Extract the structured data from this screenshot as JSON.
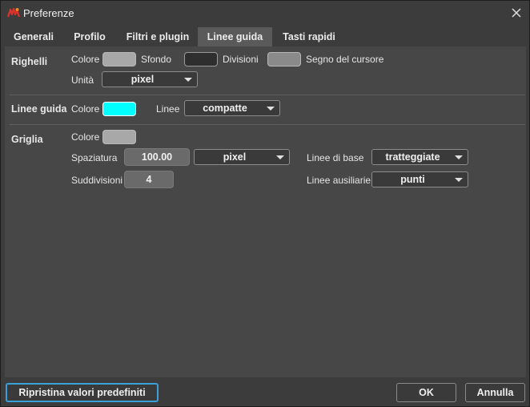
{
  "window": {
    "title": "Preferenze"
  },
  "tabs": [
    {
      "label": "Generali"
    },
    {
      "label": "Profilo"
    },
    {
      "label": "Filtri e plugin"
    },
    {
      "label": "Linee guida",
      "active": true
    },
    {
      "label": "Tasti rapidi"
    }
  ],
  "rulers": {
    "section_label": "Righelli",
    "color_label": "Colore",
    "color_value": "#a8a8a8",
    "background_label": "Sfondo",
    "background_value": "#2e2e2e",
    "divisions_label": "Divisioni",
    "divisions_value": "#8a8a8a",
    "cursor_label": "Segno del cursore",
    "unit_label": "Unità",
    "unit_value": "pixel"
  },
  "guides": {
    "section_label": "Linee guida",
    "color_label": "Colore",
    "color_value": "#00ffff",
    "lines_label": "Linee",
    "lines_value": "compatte"
  },
  "grid": {
    "section_label": "Griglia",
    "color_label": "Colore",
    "color_value": "#a8a8a8",
    "spacing_label": "Spaziatura",
    "spacing_value": "100.00",
    "spacing_unit": "pixel",
    "subdivisions_label": "Suddivisioni",
    "subdivisions_value": "4",
    "base_lines_label": "Linee di base",
    "base_lines_value": "tratteggiate",
    "aux_lines_label": "Linee ausiliarie",
    "aux_lines_value": "punti"
  },
  "footer": {
    "reset_label": "Ripristina valori predefiniti",
    "ok_label": "OK",
    "cancel_label": "Annulla"
  },
  "colors": {
    "focus": "#3aa0d8",
    "logo_red": "#e0302a",
    "logo_orange": "#f08a24"
  },
  "icons": {
    "app": "app-logo-icon",
    "close": "close-icon",
    "dropdown": "chevron-down-icon"
  }
}
